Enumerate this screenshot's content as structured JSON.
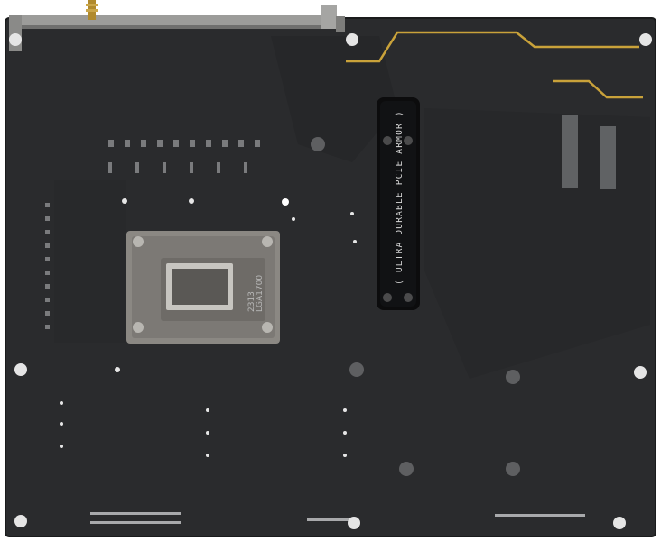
{
  "photo": {
    "subject": "motherboard-rear",
    "colors": {
      "background": "#ffffff",
      "pcb": "#2a2b2d",
      "pcb_dark": "#1d1e20",
      "trace_gold": "#c9a23a",
      "silver": "#9a9a98",
      "armor": "#0c0c0d"
    }
  },
  "backplate": {
    "line1": "LGA1700",
    "line2": "2313"
  },
  "pcie_armor": {
    "label": "( ULTRA DURABLE PCIE ARMOR )"
  },
  "icons": [
    "mounting-hole-icon",
    "screw-head-icon",
    "antenna-connector-icon"
  ]
}
